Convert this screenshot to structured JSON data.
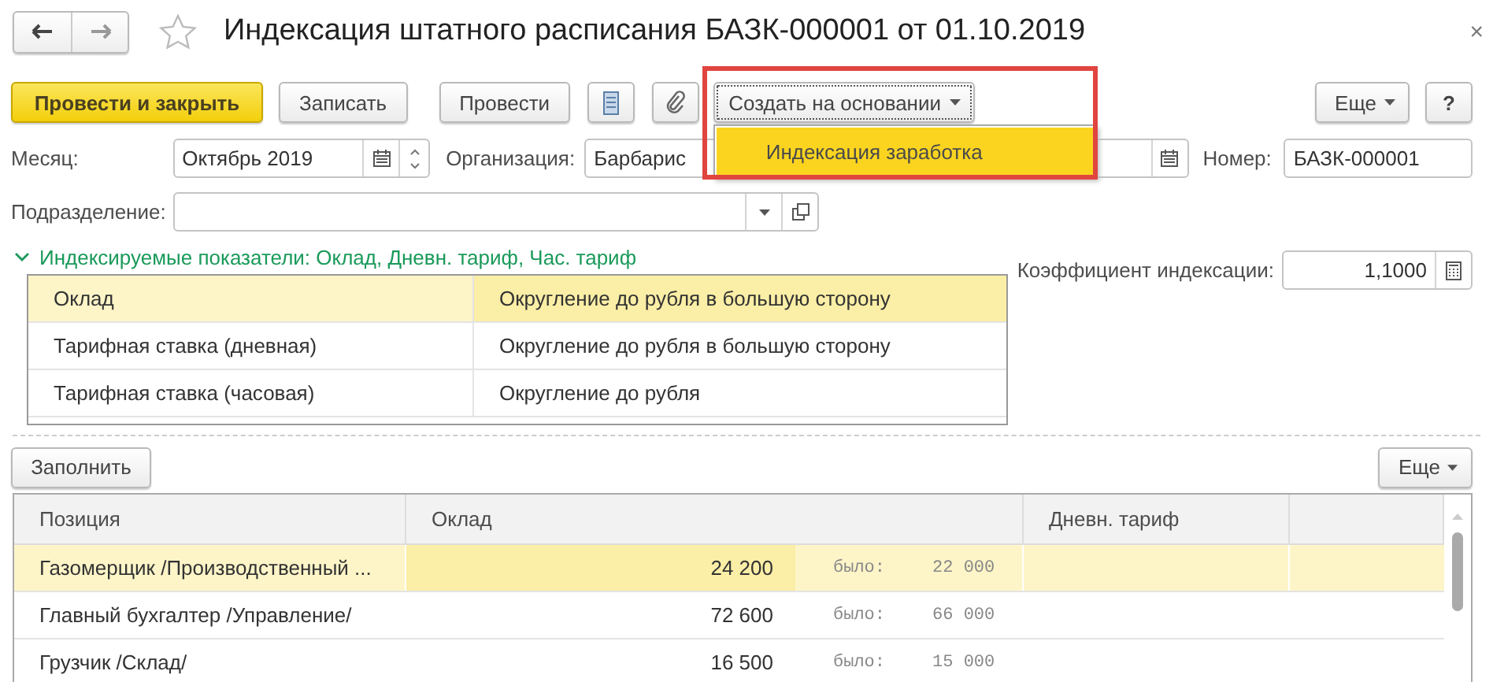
{
  "window": {
    "title": "Индексация штатного расписания БАЗК-000001 от 01.10.2019",
    "close": "×"
  },
  "toolbar": {
    "buttons": [
      {
        "kind": "primary",
        "label": "Провести и закрыть"
      },
      {
        "kind": "normal",
        "label": "Записать"
      },
      {
        "kind": "normal",
        "label": "Провести"
      },
      {
        "kind": "list"
      },
      {
        "kind": "clip"
      },
      {
        "kind": "menu",
        "label": "Создать на основании",
        "expanded": true,
        "items": [
          {
            "label": "Индексация заработка",
            "selected": true
          }
        ]
      }
    ],
    "more": "Еще",
    "help": "?"
  },
  "fields": {
    "month": {
      "label": "Месяц:",
      "value": "Октябрь 2019"
    },
    "organization": {
      "label": "Организация:",
      "value": "Барбарис"
    },
    "number": {
      "label": "Номер:",
      "value": "БАЗК-000001"
    },
    "department": {
      "label": "Подразделение:"
    },
    "coefficient": {
      "label": "Коэффициент индексации:",
      "value": "1,1000"
    }
  },
  "group": {
    "title": "Индексируемые показатели: Оклад, Дневн. тариф, Час. тариф",
    "expanded": true,
    "rows": [
      {
        "indicator": "Оклад",
        "rounding": "Округление до рубля в большую сторону",
        "selected": true
      },
      {
        "indicator": "Тарифная ставка (дневная)",
        "rounding": "Округление до рубля в большую сторону",
        "selected": false
      },
      {
        "indicator": "Тарифная ставка (часовая)",
        "rounding": "Округление до рубля",
        "selected": false
      }
    ]
  },
  "table_bar": {
    "fill": "Заполнить",
    "more": "Еще"
  },
  "table": {
    "columns": [
      "Позиция",
      "Оклад",
      "Дневн. тариф"
    ],
    "rows": [
      {
        "position": "Газомерщик /Производственный ...",
        "salary": "24 200",
        "was_label": "было:",
        "was": "22 000",
        "selected": true
      },
      {
        "position": "Главный бухгалтер /Управление/",
        "salary": "72 600",
        "was_label": "было:",
        "was": "66 000",
        "selected": false
      },
      {
        "position": "Грузчик /Склад/",
        "salary": "16 500",
        "was_label": "было:",
        "was": "15 000",
        "selected": false
      }
    ]
  }
}
